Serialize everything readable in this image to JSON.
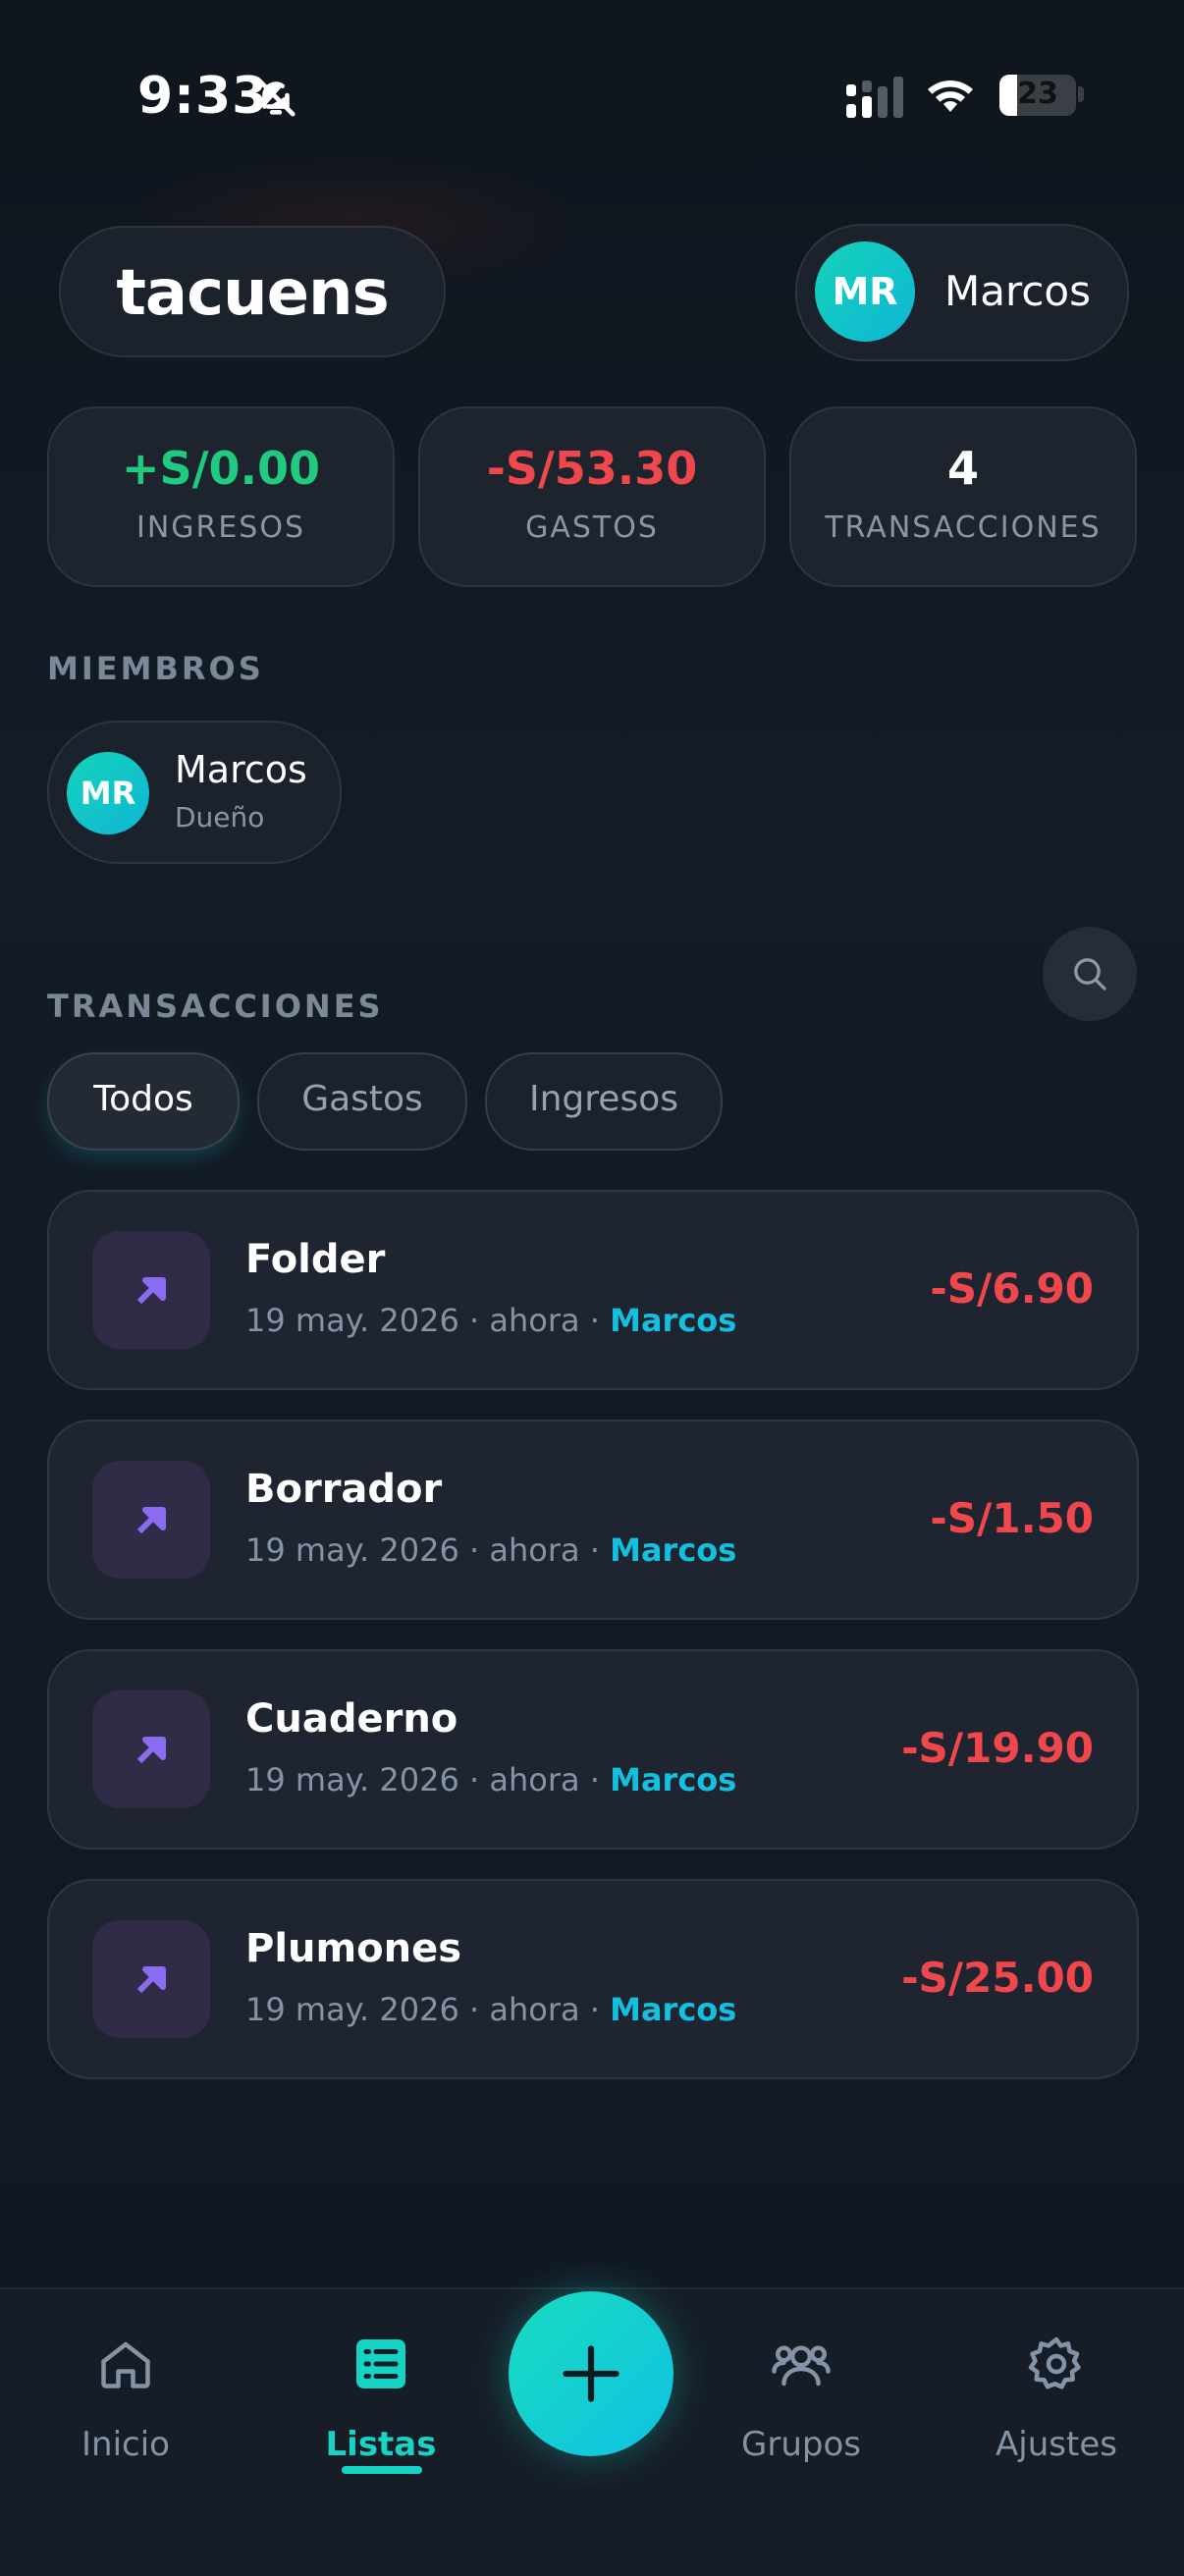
{
  "status_bar": {
    "time": "9:33",
    "battery": "23",
    "battery_level": 0.23
  },
  "header": {
    "logo": "tacuens",
    "user": {
      "initials": "MR",
      "name": "Marcos"
    }
  },
  "stats": [
    {
      "value": "+S/0.00",
      "label": "INGRESOS",
      "color": "#1ecb7f"
    },
    {
      "value": "-S/53.30",
      "label": "GASTOS",
      "color": "#f0474c"
    },
    {
      "value": "4",
      "label": "TRANSACCIONES",
      "color": "#ffffff"
    }
  ],
  "members": {
    "section_label": "MIEMBROS",
    "items": [
      {
        "initials": "MR",
        "name": "Marcos",
        "role": "Dueño"
      }
    ]
  },
  "transactions": {
    "section_label": "TRANSACCIONES",
    "filters": [
      {
        "label": "Todos",
        "active": true
      },
      {
        "label": "Gastos",
        "active": false
      },
      {
        "label": "Ingresos",
        "active": false
      }
    ],
    "items": [
      {
        "title": "Folder",
        "meta": "19 may. 2026 · ahora · ",
        "member": "Marcos",
        "amount": "-S/6.90"
      },
      {
        "title": "Borrador",
        "meta": "19 may. 2026 · ahora · ",
        "member": "Marcos",
        "amount": "-S/1.50"
      },
      {
        "title": "Cuaderno",
        "meta": "19 may. 2026 · ahora · ",
        "member": "Marcos",
        "amount": "-S/19.90"
      },
      {
        "title": "Plumones",
        "meta": "19 may. 2026 · ahora · ",
        "member": "Marcos",
        "amount": "-S/25.00"
      }
    ]
  },
  "nav": {
    "items": [
      {
        "label": "Inicio",
        "icon": "home-icon",
        "active": false
      },
      {
        "label": "Listas",
        "icon": "list-icon",
        "active": true
      },
      {
        "label": "Grupos",
        "icon": "group-icon",
        "active": false
      },
      {
        "label": "Ajustes",
        "icon": "gear-icon",
        "active": false
      }
    ],
    "fab_icon": "plus-icon"
  },
  "colors": {
    "accent": "#16d4c4",
    "expense": "#f0474c",
    "income": "#1ecb7f",
    "member_link": "#14c0e0"
  }
}
